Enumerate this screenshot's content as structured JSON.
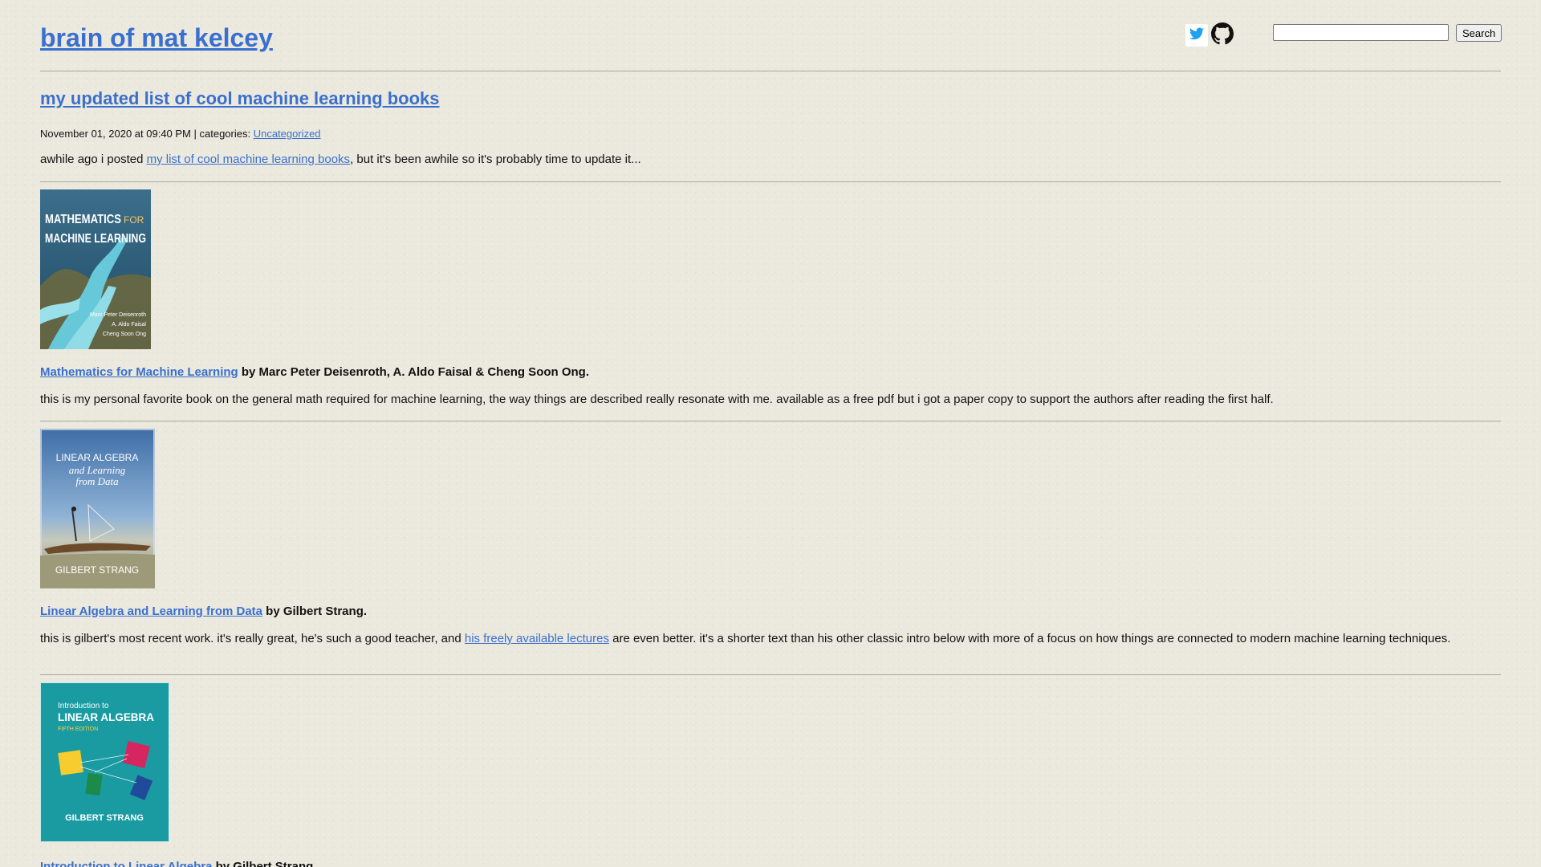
{
  "header": {
    "site_title": "brain of mat kelcey",
    "search": {
      "placeholder": "",
      "value": "",
      "button_label": "Search"
    },
    "social": [
      {
        "name": "twitter",
        "icon": "twitter-icon",
        "color": "#1da1f2"
      },
      {
        "name": "github",
        "icon": "github-icon",
        "color": "#111111"
      }
    ]
  },
  "post": {
    "title": "my updated list of cool machine learning books",
    "meta": {
      "date": "November 01, 2020 at 09:40 PM",
      "separator": " | ",
      "categories_label": "categories: ",
      "category": "Uncategorized"
    },
    "intro": {
      "before": "awhile ago i posted ",
      "link": "my list of cool machine learning books",
      "after": ", but it's been awhile so it's probably time to update it..."
    },
    "books": [
      {
        "title": "Mathematics for Machine Learning",
        "authors": " by Marc Peter Deisenroth, A. Aldo Faisal & Cheng Soon Ong.",
        "cover": {
          "title_line1": "MATHEMATICS",
          "title_for": "FOR",
          "title_line2": "MACHINE LEARNING",
          "authors": [
            "Marc Peter Deisenroth",
            "A. Aldo Faisal",
            "Cheng Soon Ong"
          ]
        },
        "description": {
          "before": "this is my personal favorite book on the general math required for machine learning, the way things are described really resonate with me. available as a free pdf but i got a paper copy to support the authors after reading the first half.",
          "link": "",
          "after": ""
        }
      },
      {
        "title": "Linear Algebra and Learning from Data",
        "authors": " by Gilbert Strang.",
        "cover": {
          "title_line1": "LINEAR ALGEBRA",
          "title_line2": "and Learning",
          "title_line3": "from Data",
          "author": "GILBERT STRANG"
        },
        "description": {
          "before": "this is gilbert's most recent work. it's really great, he's such a good teacher, and ",
          "link": "his freely available lectures",
          "after": " are even better. it's a shorter text than his other classic intro below with more of a focus on how things are connected to modern machine learning techniques."
        }
      },
      {
        "title": "Introduction to Linear Algebra",
        "authors": " by Gilbert Strang.",
        "cover": {
          "title_line1": "Introduction to",
          "title_line2": "LINEAR ALGEBRA",
          "edition": "FIFTH EDITION",
          "author": "GILBERT STRANG"
        }
      }
    ]
  },
  "colors": {
    "background": "#ebe9dd",
    "link": "#3a6fcf",
    "cover1_bg": "#2d5d7a",
    "cover2_bg": "#5a7fb0",
    "cover3_bg": "#1a9ba2"
  }
}
